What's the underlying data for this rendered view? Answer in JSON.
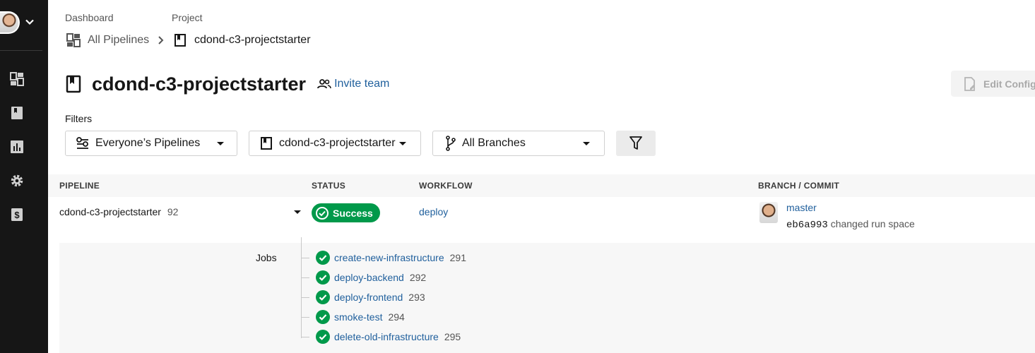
{
  "breadcrumb": {
    "dashboard_label": "Dashboard",
    "project_label": "Project",
    "all_pipelines": "All Pipelines",
    "project_name": "cdond-c3-projectstarter"
  },
  "header": {
    "title": "cdond-c3-projectstarter",
    "invite_label": "Invite team",
    "edit_config_label": "Edit Config"
  },
  "filters": {
    "label": "Filters",
    "pipelines": "Everyone’s Pipelines",
    "project": "cdond-c3-projectstarter",
    "branches": "All Branches"
  },
  "table": {
    "headers": {
      "pipeline": "PIPELINE",
      "status": "STATUS",
      "workflow": "WORKFLOW",
      "branch_commit": "BRANCH / COMMIT"
    },
    "row": {
      "pipeline_name": "cdond-c3-projectstarter",
      "pipeline_number": "92",
      "status": "Success",
      "workflow": "deploy",
      "branch": "master",
      "commit_hash": "eb6a993",
      "commit_message": "changed run space"
    },
    "jobs_label": "Jobs",
    "jobs": [
      {
        "name": "create-new-infrastructure",
        "number": "291"
      },
      {
        "name": "deploy-backend",
        "number": "292"
      },
      {
        "name": "deploy-frontend",
        "number": "293"
      },
      {
        "name": "smoke-test",
        "number": "294"
      },
      {
        "name": "delete-old-infrastructure",
        "number": "295"
      }
    ]
  },
  "colors": {
    "sidebar": "#161616",
    "success": "#00994a",
    "link": "#1f5f9c"
  },
  "icons": {
    "sidebar": [
      "dashboard-icon",
      "projects-icon",
      "insights-icon",
      "settings-icon",
      "plan-icon"
    ]
  }
}
